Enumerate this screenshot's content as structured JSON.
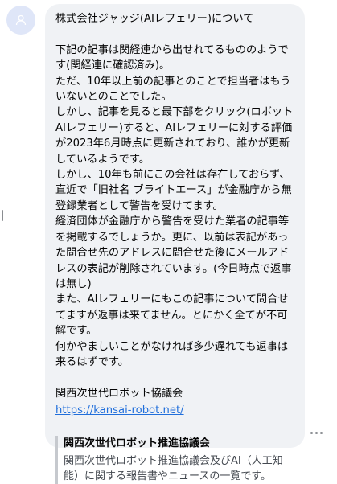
{
  "avatar": {
    "icon": "default-user-icon"
  },
  "message": {
    "text": "株式会社ジャッジ(AIレフェリー)について\n\n下記の記事は関経連から出せれてるもののようです(関経連に確認済み)。\nただ、10年以上前の記事とのことで担当者はもういないとのことでした。\nしかし、記事を見ると最下部をクリック(ロボット AIレフェリー)すると、AIレフェリーに対する評価が2023年6月時点に更新されており、誰かが更新しているようです。\nしかし、10年も前にこの会社は存在しておらず、直近で「旧社名 ブライトエース」が金融庁から無登録業者として警告を受けてます。\n経済団体が金融庁から警告を受けた業者の記事等を掲載するでしょうか。更に、以前は表記があった問合せ先のアドレスに問合せた後にメールアドレスの表記が削除されています。(今日時点で返事は無し)\nまた、AIレフェリーにもこの記事について問合せてますが返事は来てません。とにかく全てが不可解です。\n何かやましいことがなければ多少遅れても返事は来るはずです。\n\n関西次世代ロボット協議会",
    "link": "https://kansai-robot.net/",
    "preview": {
      "title": "関西次世代ロボット推進協議会",
      "description": "関西次世代ロボット推進協議会及びAI（人工知能）に関する報告書やニュースの一覧です。"
    }
  },
  "more_icon": "more-horizontal-icon"
}
